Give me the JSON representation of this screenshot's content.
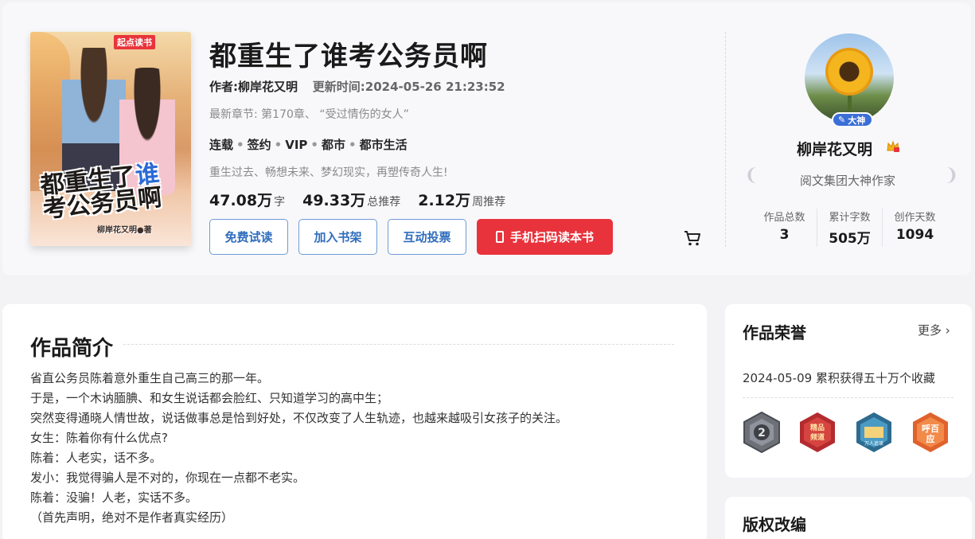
{
  "book": {
    "title": "都重生了谁考公务员啊",
    "author_label": "作者:柳岸花又明",
    "update_label": "更新时间:2024-05-26 21:23:52",
    "latest_chapter": "最新章节: 第170章、 “受过情伤的女人”",
    "tags": [
      "连载",
      "签约",
      "VIP",
      "都市",
      "都市生活"
    ],
    "slogan": "重生过去、畅想未来、梦幻现实，再塑传奇人生!",
    "stats": [
      {
        "value": "47.08万",
        "unit": "字"
      },
      {
        "value": "49.33万",
        "unit": "总推荐"
      },
      {
        "value": "2.12万",
        "unit": "周推荐"
      }
    ]
  },
  "cover": {
    "brand": "起点读书",
    "title_part1": "都重生了",
    "title_part2": "谁",
    "title_line2": "考公务员啊",
    "author": "柳岸花又明●著"
  },
  "actions": {
    "read": "免费试读",
    "shelf": "加入书架",
    "vote": "互动投票",
    "scan": "手机扫码读本书"
  },
  "author": {
    "badge": "大神",
    "name": "柳岸花又明",
    "title": "阅文集团大神作家",
    "stats": [
      {
        "label": "作品总数",
        "value": "3"
      },
      {
        "label": "累计字数",
        "value": "505万"
      },
      {
        "label": "创作天数",
        "value": "1094"
      }
    ]
  },
  "intro": {
    "heading": "作品简介",
    "lines": [
      "省直公务员陈着意外重生自己高三的那一年。",
      "于是，一个木讷腼腆、和女生说话都会脸红、只知道学习的高中生；",
      "突然变得通晓人情世故，说话做事总是恰到好处，不仅改变了人生轨迹，也越来越吸引女孩子的关注。",
      "女生：陈着你有什么优点?",
      "陈着：人老实，话不多。",
      "发小：我觉得骗人是不对的，你现在一点都不老实。",
      "陈着：没骗！人老，实话不多。",
      "（首先声明，绝对不是作者真实经历）"
    ]
  },
  "honor": {
    "heading": "作品荣誉",
    "more": "更多",
    "item": "2024-05-09 累积获得五十万个收藏",
    "medals": [
      "2",
      "精品频道",
      "万人追读",
      "呼百应"
    ]
  },
  "copyright": {
    "heading": "版权改编"
  },
  "colors": {
    "primary_red": "#e8333c",
    "link_blue": "#2f6dbd",
    "badge_blue": "#3a6fd8"
  }
}
